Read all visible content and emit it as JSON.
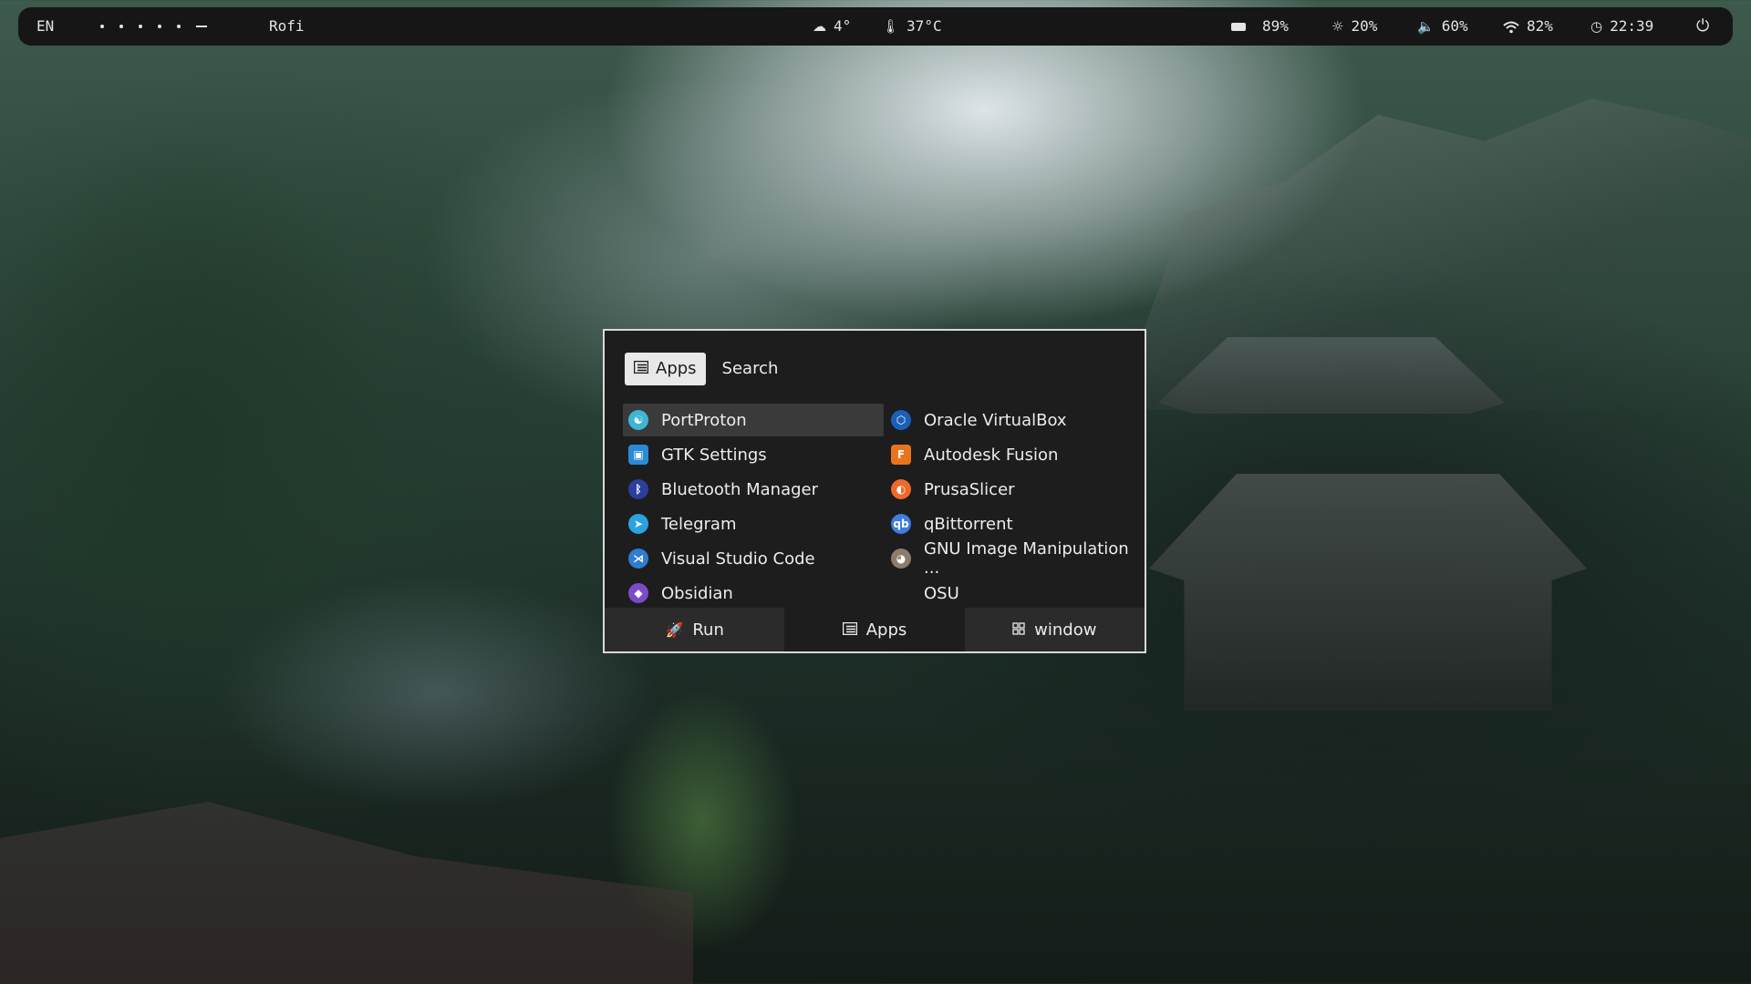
{
  "topbar": {
    "language": "EN",
    "window_title": "Rofi",
    "weather": {
      "icon": "cloud-icon",
      "value": "4°"
    },
    "temperature": {
      "icon": "thermometer-icon",
      "value": "37°C"
    },
    "battery": {
      "icon": "battery-icon",
      "value": "89%"
    },
    "brightness": {
      "icon": "brightness-icon",
      "value": "20%"
    },
    "volume": {
      "icon": "volume-icon",
      "value": "60%"
    },
    "wifi": {
      "icon": "wifi-icon",
      "value": "82%"
    },
    "clock": {
      "icon": "clock-icon",
      "value": "22:39"
    },
    "power": {
      "icon": "power-icon"
    }
  },
  "rofi": {
    "modes": [
      {
        "label": "Apps",
        "icon": "apps-list-icon",
        "active": true
      },
      {
        "label": "Search",
        "active": false
      }
    ],
    "entries_left": [
      {
        "label": "PortProton",
        "icon": "portproton-icon",
        "color": "#3fb5d6",
        "selected": true
      },
      {
        "label": "GTK Settings",
        "icon": "gtk-settings-icon",
        "color": "#2a8ad4"
      },
      {
        "label": "Bluetooth Manager",
        "icon": "bluetooth-icon",
        "color": "#2c3e9e"
      },
      {
        "label": "Telegram",
        "icon": "telegram-icon",
        "color": "#2aa3e0"
      },
      {
        "label": "Visual Studio Code",
        "icon": "vscode-icon",
        "color": "#2f7cd1"
      },
      {
        "label": "Obsidian",
        "icon": "obsidian-icon",
        "color": "#7c4bc8"
      }
    ],
    "entries_right": [
      {
        "label": "Oracle VirtualBox",
        "icon": "virtualbox-icon",
        "color": "#1c5fb8"
      },
      {
        "label": "Autodesk Fusion",
        "icon": "autodesk-fusion-icon",
        "color": "#e8741e"
      },
      {
        "label": "PrusaSlicer",
        "icon": "prusaslicer-icon",
        "color": "#ef6a2a"
      },
      {
        "label": "qBittorrent",
        "icon": "qbittorrent-icon",
        "color": "#3f7de0"
      },
      {
        "label": "GNU Image Manipulation ...",
        "icon": "gimp-icon",
        "color": "#8b7d6a"
      },
      {
        "label": "OSU",
        "icon": "",
        "color": ""
      }
    ],
    "bottom_tabs": [
      {
        "label": "Run",
        "icon": "rocket-icon"
      },
      {
        "label": "Apps",
        "icon": "apps-list-icon"
      },
      {
        "label": "window",
        "icon": "window-grid-icon"
      }
    ]
  }
}
